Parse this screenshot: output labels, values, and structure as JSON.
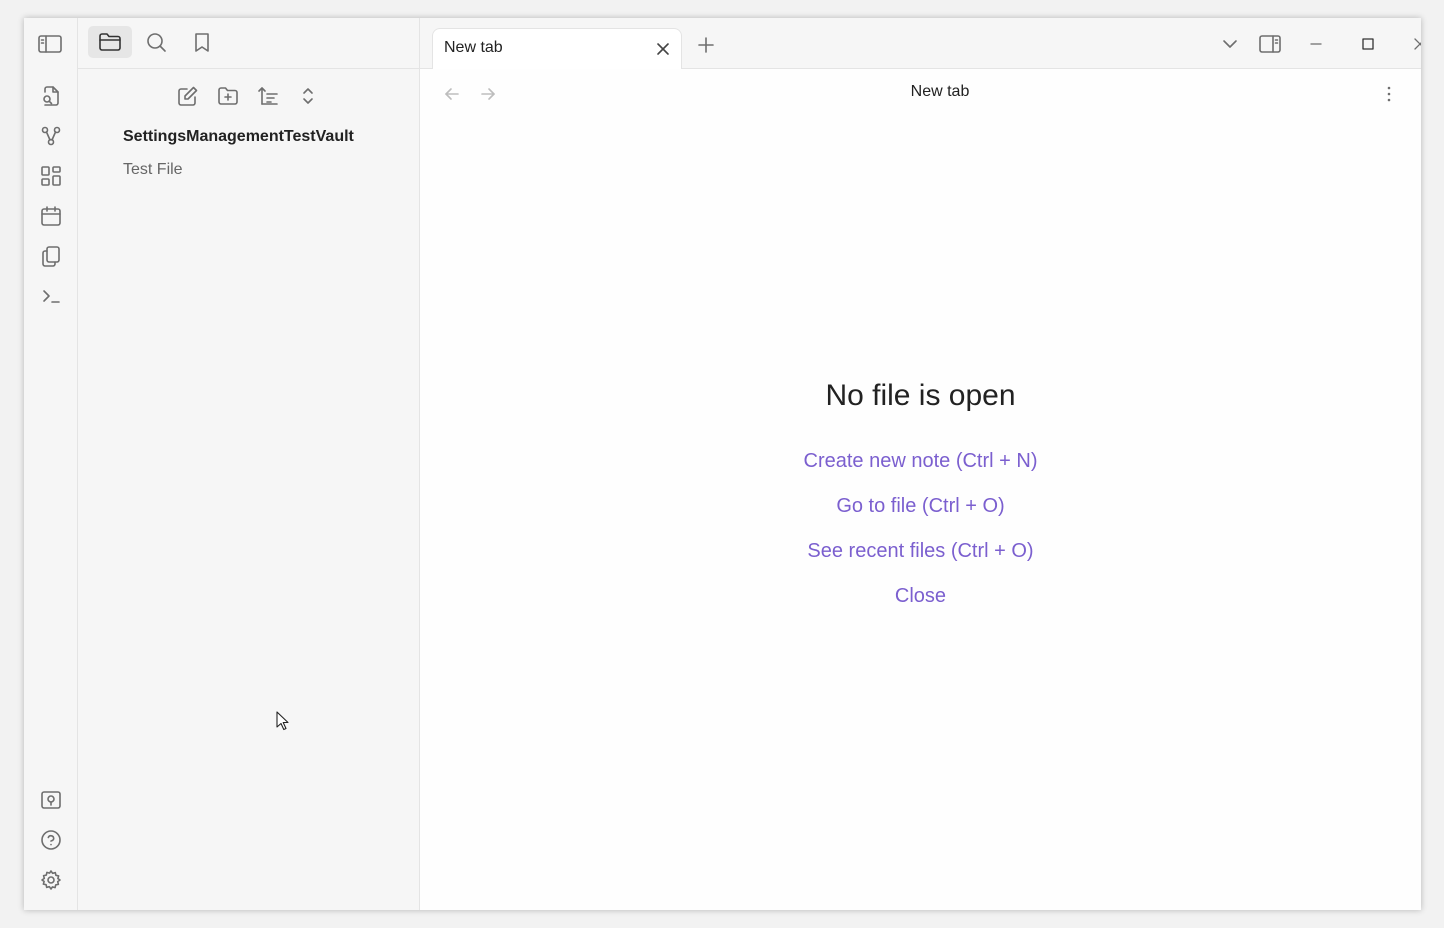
{
  "app": {
    "accent_color": "#7b5fcf"
  },
  "sidebar": {
    "header_icons": [
      "folder-icon",
      "search-icon",
      "bookmark-icon"
    ],
    "toolbar_icons": [
      "new-note-icon",
      "new-folder-icon",
      "sort-icon",
      "collapse-icon"
    ],
    "vault_name": "SettingsManagementTestVault",
    "files": [
      {
        "name": "Test File"
      }
    ]
  },
  "ribbon": {
    "top_icons": [
      "quick-switcher-icon",
      "graph-view-icon",
      "canvas-icon",
      "daily-note-icon",
      "templates-icon",
      "command-palette-icon"
    ],
    "bottom_icons": [
      "vault-switcher-icon",
      "help-icon",
      "settings-icon"
    ]
  },
  "tabs": [
    {
      "label": "New tab",
      "active": true
    }
  ],
  "view": {
    "title": "New tab",
    "empty_state": {
      "title": "No file is open",
      "actions": [
        {
          "label": "Create new note (Ctrl + N)"
        },
        {
          "label": "Go to file (Ctrl + O)"
        },
        {
          "label": "See recent files (Ctrl + O)"
        },
        {
          "label": "Close"
        }
      ]
    }
  }
}
